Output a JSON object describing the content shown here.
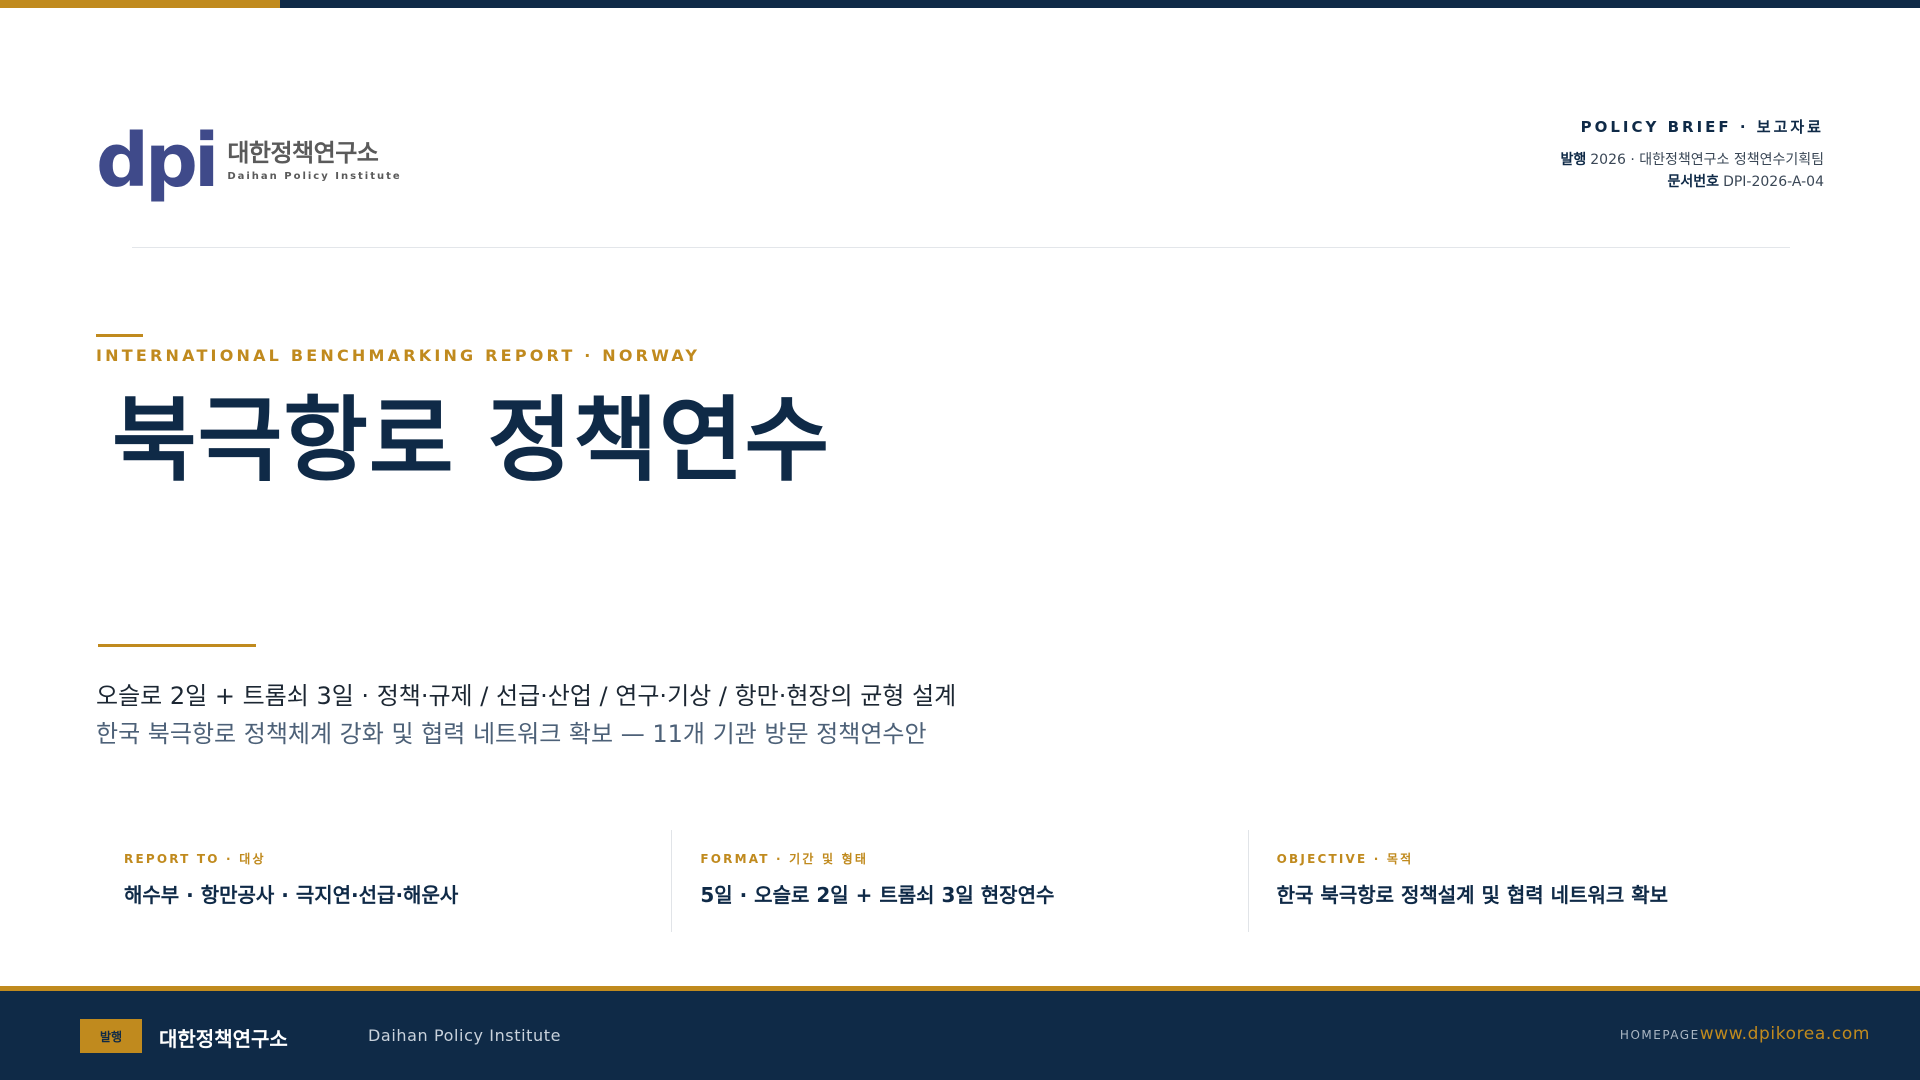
{
  "brand": {
    "logo_mark": "dpi",
    "name_kr": "대한정책연구소",
    "name_en": "Daihan Policy Institute",
    "colors": {
      "navy": "#0f2a47",
      "gold": "#c08a1e",
      "logo": "#3f4a8a"
    }
  },
  "header": {
    "brief_label": "POLICY BRIEF · 보고자료",
    "publish_label": "발행",
    "publish_value": "2026 · 대한정책연구소 정책연수기획팀",
    "docno_label": "문서번호",
    "docno_value": "DPI-2026-A-04"
  },
  "hero": {
    "eyebrow": "INTERNATIONAL BENCHMARKING REPORT · NORWAY",
    "title": "북극항로 정책연수",
    "subtitle_1": "오슬로 2일 + 트롬쇠 3일 · 정책·규제 / 선급·산업 / 연구·기상 / 항만·현장의 균형 설계",
    "subtitle_2": "한국 북극항로 정책체계 강화 및 협력 네트워크 확보 — 11개 기관 방문 정책연수안"
  },
  "cards": [
    {
      "label": "REPORT TO · 대상",
      "value": "해수부 · 항만공사 · 극지연·선급·해운사"
    },
    {
      "label": "FORMAT · 기간 및 형태",
      "value": "5일 · 오슬로 2일 + 트롬쇠 3일 현장연수"
    },
    {
      "label": "OBJECTIVE · 목적",
      "value": "한국 북극항로 정책설계 및 협력 네트워크 확보"
    }
  ],
  "footer": {
    "badge": "발행",
    "org_kr": "대한정책연구소",
    "org_en": "Daihan Policy Institute",
    "homepage_label": "HOMEPAGE",
    "homepage_url": "www.dpikorea.com"
  }
}
